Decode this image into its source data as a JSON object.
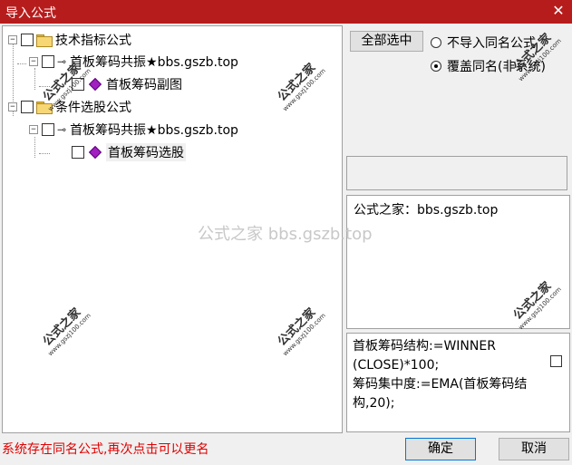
{
  "window": {
    "title": "导入公式"
  },
  "tree": {
    "nodes": [
      {
        "expander": "−",
        "type": "folder",
        "label": "技术指标公式"
      },
      {
        "expander": "−",
        "type": "key",
        "label": "首板筹码共振★bbs.gszb.top"
      },
      {
        "expander": "",
        "type": "diamond",
        "label": "首板筹码副图"
      },
      {
        "expander": "−",
        "type": "folder",
        "label": "条件选股公式"
      },
      {
        "expander": "−",
        "type": "key",
        "label": "首板筹码共振★bbs.gszb.top"
      },
      {
        "expander": "",
        "type": "diamond",
        "label": "首板筹码选股"
      }
    ]
  },
  "controls": {
    "select_all": "全部选中",
    "radio_no_import": "不导入同名公式",
    "radio_overwrite": "覆盖同名(非系统)",
    "radio_selected": "overwrite"
  },
  "info": {
    "text": "公式之家：bbs.gszb.top"
  },
  "formula": {
    "lines": [
      "首板筹码结构:=WINNER",
      "(CLOSE)*100;",
      "筹码集中度:=EMA(首板筹码结",
      "构,20);"
    ]
  },
  "status": "系统存在同名公式,再次点击可以更名",
  "buttons": {
    "ok": "确定",
    "cancel": "取消"
  },
  "watermarks": {
    "center": "公式之家 bbs.gszb.top",
    "stamp_big": "公式之家",
    "stamp_small": "www.gszj100.com"
  }
}
